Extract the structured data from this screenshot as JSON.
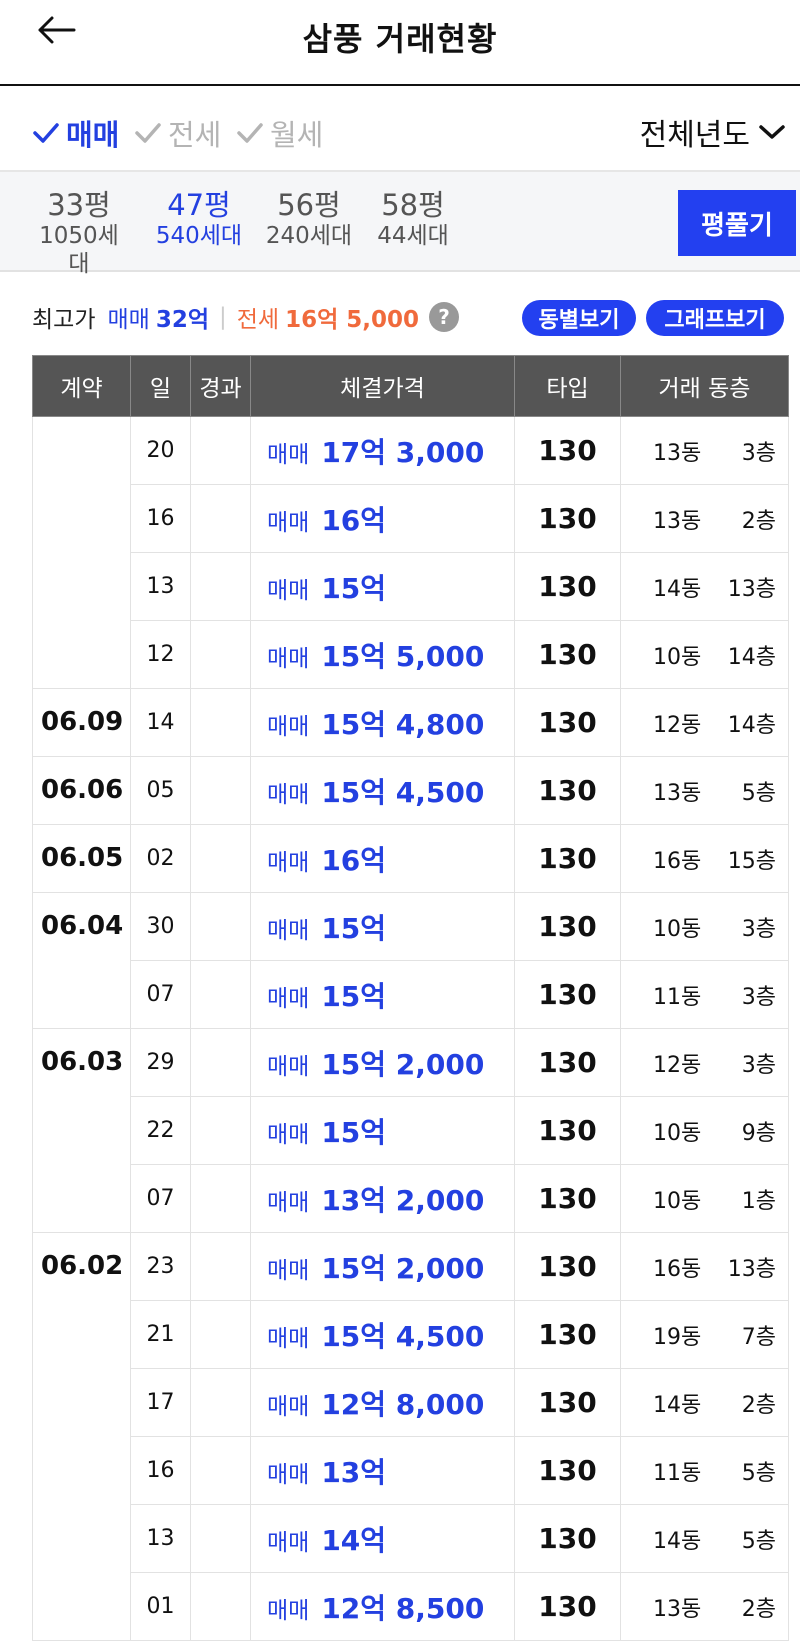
{
  "header": {
    "title": "삼풍 거래현황"
  },
  "filters": {
    "items": [
      {
        "label": "매매",
        "active": true
      },
      {
        "label": "전세",
        "active": false
      },
      {
        "label": "월세",
        "active": false
      }
    ],
    "year": "전체년도"
  },
  "sizes": [
    {
      "pyeong": "33평",
      "units": "1050세대",
      "active": false
    },
    {
      "pyeong": "47평",
      "units": "540세대",
      "active": true
    },
    {
      "pyeong": "56평",
      "units": "240세대",
      "active": false
    },
    {
      "pyeong": "58평",
      "units": "44세대",
      "active": false
    }
  ],
  "size_button": "평풀기",
  "max_price": {
    "label": "최고가",
    "sale_label": "매매",
    "sale_value": "32억",
    "jeonse_label": "전세",
    "jeonse_value": "16억 5,000",
    "help": "?"
  },
  "buttons": {
    "dong_view": "동별보기",
    "graph_view": "그래프보기"
  },
  "table": {
    "headers": [
      "계약",
      "일",
      "경과",
      "체결가격",
      "타입",
      "거래 동층"
    ],
    "rows": [
      {
        "date": "",
        "day": "20",
        "elapsed": "",
        "kind": "매매",
        "price": "17억 3,000",
        "type": "130",
        "dong": "13동",
        "floor": "3층"
      },
      {
        "date": "",
        "day": "16",
        "elapsed": "",
        "kind": "매매",
        "price": "16억",
        "type": "130",
        "dong": "13동",
        "floor": "2층"
      },
      {
        "date": "",
        "day": "13",
        "elapsed": "",
        "kind": "매매",
        "price": "15억",
        "type": "130",
        "dong": "14동",
        "floor": "13층"
      },
      {
        "date": "",
        "day": "12",
        "elapsed": "",
        "kind": "매매",
        "price": "15억 5,000",
        "type": "130",
        "dong": "10동",
        "floor": "14층"
      },
      {
        "date": "06.09",
        "day": "14",
        "elapsed": "",
        "kind": "매매",
        "price": "15억 4,800",
        "type": "130",
        "dong": "12동",
        "floor": "14층"
      },
      {
        "date": "06.06",
        "day": "05",
        "elapsed": "",
        "kind": "매매",
        "price": "15억 4,500",
        "type": "130",
        "dong": "13동",
        "floor": "5층"
      },
      {
        "date": "06.05",
        "day": "02",
        "elapsed": "",
        "kind": "매매",
        "price": "16억",
        "type": "130",
        "dong": "16동",
        "floor": "15층"
      },
      {
        "date": "06.04",
        "day": "30",
        "elapsed": "",
        "kind": "매매",
        "price": "15억",
        "type": "130",
        "dong": "10동",
        "floor": "3층"
      },
      {
        "date": "",
        "day": "07",
        "elapsed": "",
        "kind": "매매",
        "price": "15억",
        "type": "130",
        "dong": "11동",
        "floor": "3층"
      },
      {
        "date": "06.03",
        "day": "29",
        "elapsed": "",
        "kind": "매매",
        "price": "15억 2,000",
        "type": "130",
        "dong": "12동",
        "floor": "3층"
      },
      {
        "date": "",
        "day": "22",
        "elapsed": "",
        "kind": "매매",
        "price": "15억",
        "type": "130",
        "dong": "10동",
        "floor": "9층"
      },
      {
        "date": "",
        "day": "07",
        "elapsed": "",
        "kind": "매매",
        "price": "13억 2,000",
        "type": "130",
        "dong": "10동",
        "floor": "1층"
      },
      {
        "date": "06.02",
        "day": "23",
        "elapsed": "",
        "kind": "매매",
        "price": "15억 2,000",
        "type": "130",
        "dong": "16동",
        "floor": "13층"
      },
      {
        "date": "",
        "day": "21",
        "elapsed": "",
        "kind": "매매",
        "price": "15억 4,500",
        "type": "130",
        "dong": "19동",
        "floor": "7층"
      },
      {
        "date": "",
        "day": "17",
        "elapsed": "",
        "kind": "매매",
        "price": "12억 8,000",
        "type": "130",
        "dong": "14동",
        "floor": "2층"
      },
      {
        "date": "",
        "day": "16",
        "elapsed": "",
        "kind": "매매",
        "price": "13억",
        "type": "130",
        "dong": "11동",
        "floor": "5층"
      },
      {
        "date": "",
        "day": "13",
        "elapsed": "",
        "kind": "매매",
        "price": "14억",
        "type": "130",
        "dong": "14동",
        "floor": "5층"
      },
      {
        "date": "",
        "day": "01",
        "elapsed": "",
        "kind": "매매",
        "price": "12억 8,500",
        "type": "130",
        "dong": "13동",
        "floor": "2층"
      }
    ]
  }
}
